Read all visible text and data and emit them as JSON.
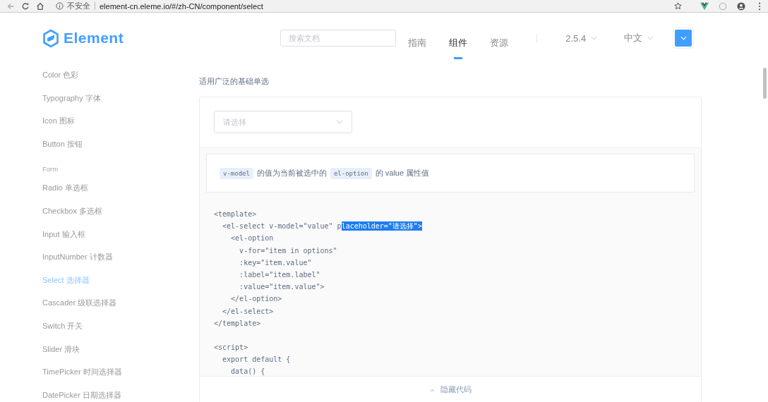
{
  "browser": {
    "security": "不安全",
    "url": "element-cn.eleme.io/#/zh-CN/component/select"
  },
  "header": {
    "logo": "Element",
    "search": {
      "placeholder": "搜索文档"
    },
    "nav": [
      {
        "label": "指南",
        "selected": false
      },
      {
        "label": "组件",
        "selected": true
      },
      {
        "label": "资源",
        "selected": false
      }
    ],
    "version": "2.5.4",
    "language": "中文"
  },
  "sidebar": {
    "items": [
      {
        "kind": "link",
        "label": "Color 色彩",
        "selected": false
      },
      {
        "kind": "link",
        "label": "Typography 字体",
        "selected": false
      },
      {
        "kind": "link",
        "label": "Icon 图标",
        "selected": false
      },
      {
        "kind": "link",
        "label": "Button 按钮",
        "selected": false
      },
      {
        "kind": "group",
        "label": "Form",
        "selected": false
      },
      {
        "kind": "link",
        "label": "Radio 单选框",
        "selected": false
      },
      {
        "kind": "link",
        "label": "Checkbox 多选框",
        "selected": false
      },
      {
        "kind": "link",
        "label": "Input 输入框",
        "selected": false
      },
      {
        "kind": "link",
        "label": "InputNumber 计数器",
        "selected": false
      },
      {
        "kind": "link",
        "label": "Select 选择器",
        "selected": true
      },
      {
        "kind": "link",
        "label": "Cascader 级联选择器",
        "selected": false
      },
      {
        "kind": "link",
        "label": "Switch 开关",
        "selected": false
      },
      {
        "kind": "link",
        "label": "Slider 滑块",
        "selected": false
      },
      {
        "kind": "link",
        "label": "TimePicker 时间选择器",
        "selected": false
      },
      {
        "kind": "link",
        "label": "DatePicker 日期选择器",
        "selected": false
      }
    ]
  },
  "main": {
    "description": "适用广泛的基础单选",
    "select": {
      "placeholder": "请选择"
    },
    "note": [
      {
        "kind": "code",
        "text": "v-model"
      },
      {
        "kind": "text",
        "text": "的值为当前被选中的"
      },
      {
        "kind": "code",
        "text": "el-option"
      },
      {
        "kind": "text",
        "text": "的 value 属性值"
      }
    ],
    "code": [
      {
        "kind": "line",
        "segments": [
          {
            "text": "<template>",
            "selected": false
          }
        ]
      },
      {
        "kind": "line",
        "segments": [
          {
            "text": "  <el-select v-model=\"value\" p",
            "selected": false
          },
          {
            "text": "laceholder=\"请选择\">",
            "selected": true
          }
        ]
      },
      {
        "kind": "line",
        "segments": [
          {
            "text": "    <el-option",
            "selected": false
          }
        ]
      },
      {
        "kind": "line",
        "segments": [
          {
            "text": "      v-for=\"item in options\"",
            "selected": false
          }
        ]
      },
      {
        "kind": "line",
        "segments": [
          {
            "text": "      :key=\"item.value\"",
            "selected": false
          }
        ]
      },
      {
        "kind": "line",
        "segments": [
          {
            "text": "      :label=\"item.label\"",
            "selected": false
          }
        ]
      },
      {
        "kind": "line",
        "segments": [
          {
            "text": "      :value=\"item.value\">",
            "selected": false
          }
        ]
      },
      {
        "kind": "line",
        "segments": [
          {
            "text": "    </el-option>",
            "selected": false
          }
        ]
      },
      {
        "kind": "line",
        "segments": [
          {
            "text": "  </el-select>",
            "selected": false
          }
        ]
      },
      {
        "kind": "line",
        "segments": [
          {
            "text": "</template>",
            "selected": false
          }
        ]
      },
      {
        "kind": "blank"
      },
      {
        "kind": "line",
        "segments": [
          {
            "text": "<script>",
            "selected": false
          }
        ]
      },
      {
        "kind": "line",
        "segments": [
          {
            "text": "  export default {",
            "selected": false
          }
        ]
      },
      {
        "kind": "line",
        "segments": [
          {
            "text": "    data() {",
            "selected": false
          }
        ]
      }
    ],
    "hide_code": "隐藏代码"
  }
}
